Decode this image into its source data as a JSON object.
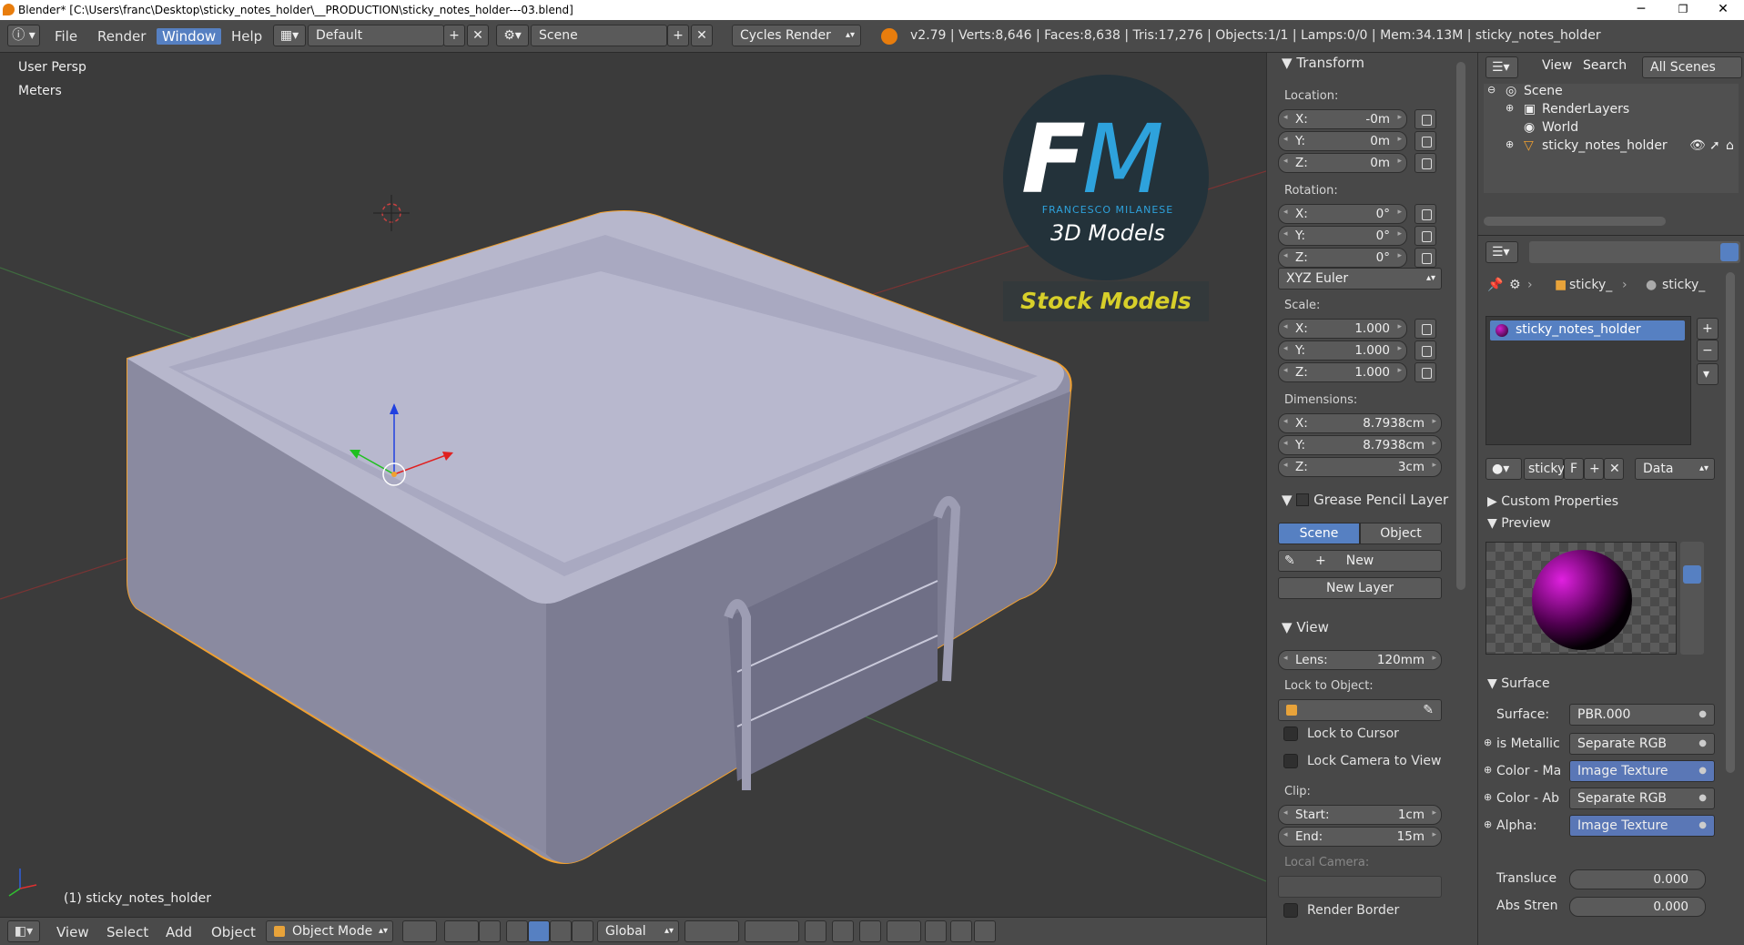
{
  "titlebar": {
    "title": "Blender* [C:\\Users\\franc\\Desktop\\sticky_notes_holder\\__PRODUCTION\\sticky_notes_holder---03.blend]",
    "minimize": "─",
    "maximize": "❐",
    "close": "✕"
  },
  "menu": {
    "file": "File",
    "render": "Render",
    "window": "Window",
    "help": "Help"
  },
  "header": {
    "screen_layout": "Default",
    "scene": "Scene",
    "engine": "Cycles Render",
    "stats": "v2.79 | Verts:8,646 | Faces:8,638 | Tris:17,276 | Objects:1/1 | Lamps:0/0 | Mem:34.13M | sticky_notes_holder"
  },
  "viewport": {
    "perspective": "User Persp",
    "units": "Meters",
    "object_label": "(1) sticky_notes_holder"
  },
  "logo": {
    "letter_f": "F",
    "letter_m": "M",
    "subtitle": "FRANCESCO MILANESE",
    "models": "3D Models",
    "banner": "Stock Models"
  },
  "bottombar": {
    "view": "View",
    "select": "Select",
    "add": "Add",
    "object": "Object",
    "mode": "Object Mode",
    "orientation": "Global"
  },
  "transform": {
    "header": "Transform",
    "location_label": "Location:",
    "location": [
      {
        "axis": "X:",
        "value": "-0m"
      },
      {
        "axis": "Y:",
        "value": "0m"
      },
      {
        "axis": "Z:",
        "value": "0m"
      }
    ],
    "rotation_label": "Rotation:",
    "rotation": [
      {
        "axis": "X:",
        "value": "0°"
      },
      {
        "axis": "Y:",
        "value": "0°"
      },
      {
        "axis": "Z:",
        "value": "0°"
      }
    ],
    "rotation_mode": "XYZ Euler",
    "scale_label": "Scale:",
    "scale": [
      {
        "axis": "X:",
        "value": "1.000"
      },
      {
        "axis": "Y:",
        "value": "1.000"
      },
      {
        "axis": "Z:",
        "value": "1.000"
      }
    ],
    "dimensions_label": "Dimensions:",
    "dimensions": [
      {
        "axis": "X:",
        "value": "8.7938cm"
      },
      {
        "axis": "Y:",
        "value": "8.7938cm"
      },
      {
        "axis": "Z:",
        "value": "3cm"
      }
    ]
  },
  "grease_pencil": {
    "header": "Grease Pencil Layer",
    "tab_scene": "Scene",
    "tab_object": "Object",
    "new": "New",
    "new_layer": "New Layer"
  },
  "view_panel": {
    "header": "View",
    "lens_label": "Lens:",
    "lens_value": "120mm",
    "lock_object_label": "Lock to Object:",
    "lock_cursor": "Lock to Cursor",
    "lock_camera": "Lock Camera to View",
    "clip_label": "Clip:",
    "clip_start_label": "Start:",
    "clip_start": "1cm",
    "clip_end_label": "End:",
    "clip_end": "15m",
    "local_camera": "Local Camera:",
    "render_border": "Render Border"
  },
  "outliner": {
    "view": "View",
    "search": "Search",
    "filter": "All Scenes",
    "items": [
      "Scene",
      "RenderLayers",
      "World",
      "sticky_notes_holder"
    ]
  },
  "properties": {
    "breadcrumb_object": "sticky_",
    "breadcrumb_material": "sticky_",
    "material_slot": "sticky_notes_holder",
    "material_name": "sticky",
    "fake_user": "F",
    "link": "Data",
    "custom_properties": "Custom Properties",
    "preview": "Preview",
    "surface_header": "Surface",
    "surface_label": "Surface:",
    "surface_value": "PBR.000",
    "rows": [
      {
        "label": "is Metallic",
        "value": "Separate RGB",
        "blue": false
      },
      {
        "label": "Color - Ma",
        "value": "Image Texture",
        "blue": true
      },
      {
        "label": "Color - Ab",
        "value": "Separate RGB",
        "blue": false
      },
      {
        "label": "Alpha:",
        "value": "Image Texture",
        "blue": true
      }
    ],
    "translucency_label": "Transluce",
    "translucency_value": "0.000",
    "abs_strength_label": "Abs Stren",
    "abs_strength_value": "0.000"
  },
  "colors": {
    "accent_blue": "#5680c2",
    "selection_orange": "#f0a030",
    "logo_blue": "#2ea2dc",
    "banner_yellow": "#d7cf2a"
  }
}
